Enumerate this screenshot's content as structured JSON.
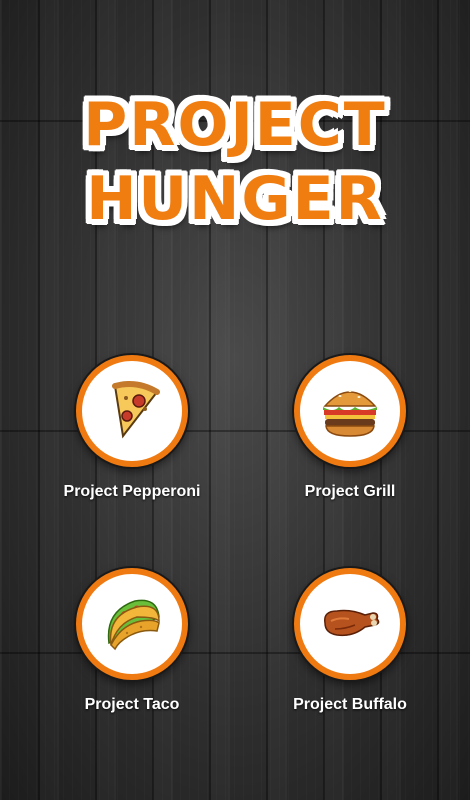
{
  "app": {
    "title_line1": "PROJECT",
    "title_line2": "HUNGER"
  },
  "menu": {
    "items": [
      {
        "label": "Project Pepperoni",
        "icon": "pizza-slice-icon"
      },
      {
        "label": "Project Grill",
        "icon": "burger-icon"
      },
      {
        "label": "Project Taco",
        "icon": "taco-icon"
      },
      {
        "label": "Project Buffalo",
        "icon": "chicken-wing-icon"
      }
    ]
  },
  "colors": {
    "accent": "#f07d10",
    "background": "#2f2f2f",
    "label": "#ffffff"
  }
}
